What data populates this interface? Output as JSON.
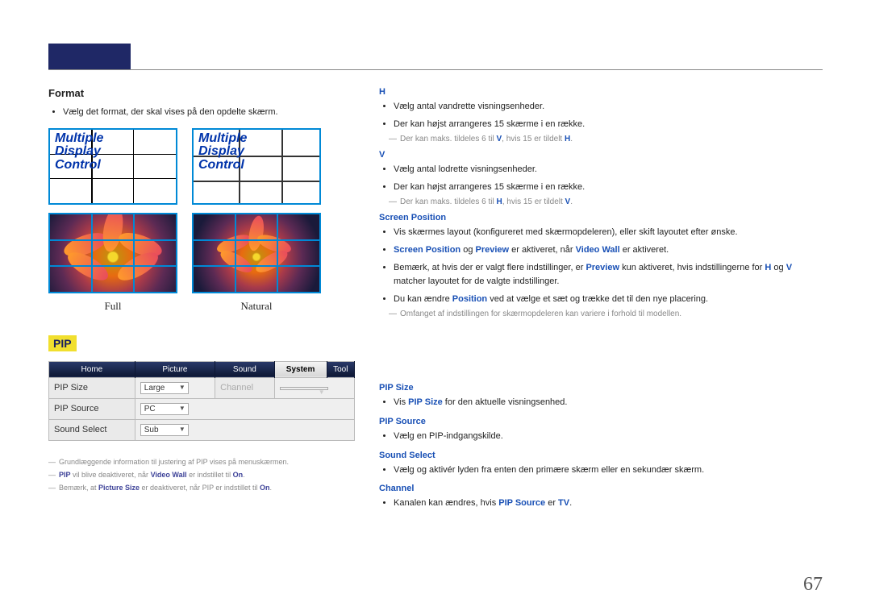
{
  "format": {
    "heading": "Format",
    "bullet": "Vælg det format, der skal vises på den opdelte skærm.",
    "mdc_text": "Multiple Display Control",
    "caption_full": "Full",
    "caption_natural": "Natural"
  },
  "right": {
    "h_heading": "H",
    "h_b1": "Vælg antal vandrette visningsenheder.",
    "h_b2": "Der kan højst arrangeres 15 skærme i en række.",
    "h_note_pre": "Der kan maks. tildeles 6 til ",
    "h_note_v": "V",
    "h_note_mid": ", hvis 15 er tildelt ",
    "h_note_h": "H",
    "h_note_end": ".",
    "v_heading": "V",
    "v_b1": "Vælg antal lodrette visningsenheder.",
    "v_b2": "Der kan højst arrangeres 15 skærme i en række.",
    "v_note_pre": "Der kan maks. tildeles 6 til ",
    "v_note_h": "H",
    "v_note_mid": ", hvis 15 er tildelt ",
    "v_note_v": "V",
    "v_note_end": ".",
    "sp_heading": "Screen Position",
    "sp_b1": "Vis skærmes layout (konfigureret med skærmopdeleren), eller skift layoutet efter ønske.",
    "sp_b2_1": "Screen Position",
    "sp_b2_2": " og ",
    "sp_b2_3": "Preview",
    "sp_b2_4": " er aktiveret, når ",
    "sp_b2_5": "Video Wall",
    "sp_b2_6": " er aktiveret.",
    "sp_b3_1": "Bemærk, at hvis der er valgt flere indstillinger, er ",
    "sp_b3_2": "Preview",
    "sp_b3_3": " kun aktiveret, hvis indstillingerne for ",
    "sp_b3_4": "H",
    "sp_b3_5": " og ",
    "sp_b3_6": "V",
    "sp_b3_7": " matcher layoutet for de valgte indstillinger.",
    "sp_b4_1": "Du kan ændre ",
    "sp_b4_2": "Position",
    "sp_b4_3": " ved at vælge et sæt og trække det til den nye placering.",
    "sp_note": "Omfanget af indstillingen for skærmopdeleren kan variere i forhold til modellen."
  },
  "pip": {
    "label": "PIP",
    "tab_home": "Home",
    "tab_picture": "Picture",
    "tab_sound": "Sound",
    "tab_system": "System",
    "tab_tool": "Tool",
    "row_pip_size": "PIP Size",
    "val_pip_size": "Large",
    "row_channel": "Channel",
    "val_channel": " ",
    "row_pip_source": "PIP Source",
    "val_pip_source": "PC",
    "row_sound_select": "Sound Select",
    "val_sound_select": "Sub",
    "note1": "Grundlæggende information til justering af PIP vises på menuskærmen.",
    "note2_1": "PIP",
    "note2_2": " vil blive deaktiveret, når ",
    "note2_3": "Video Wall",
    "note2_4": " er indstillet til ",
    "note2_5": "On",
    "note2_6": ".",
    "note3_1": "Bemærk, at ",
    "note3_2": "Picture Size",
    "note3_3": " er deaktiveret, når PIP er indstillet til ",
    "note3_4": "On",
    "note3_5": "."
  },
  "pip_right": {
    "size_h": "PIP Size",
    "size_b_1": "Vis ",
    "size_b_2": "PIP Size",
    "size_b_3": " for den aktuelle visningsenhed.",
    "source_h": "PIP Source",
    "source_b": "Vælg en PIP-indgangskilde.",
    "sound_h": "Sound Select",
    "sound_b": "Vælg og aktivér lyden fra enten den primære skærm eller en sekundær skærm.",
    "channel_h": "Channel",
    "channel_b_1": "Kanalen kan ændres, hvis ",
    "channel_b_2": "PIP Source",
    "channel_b_3": " er ",
    "channel_b_4": "TV",
    "channel_b_5": "."
  },
  "page_number": "67"
}
